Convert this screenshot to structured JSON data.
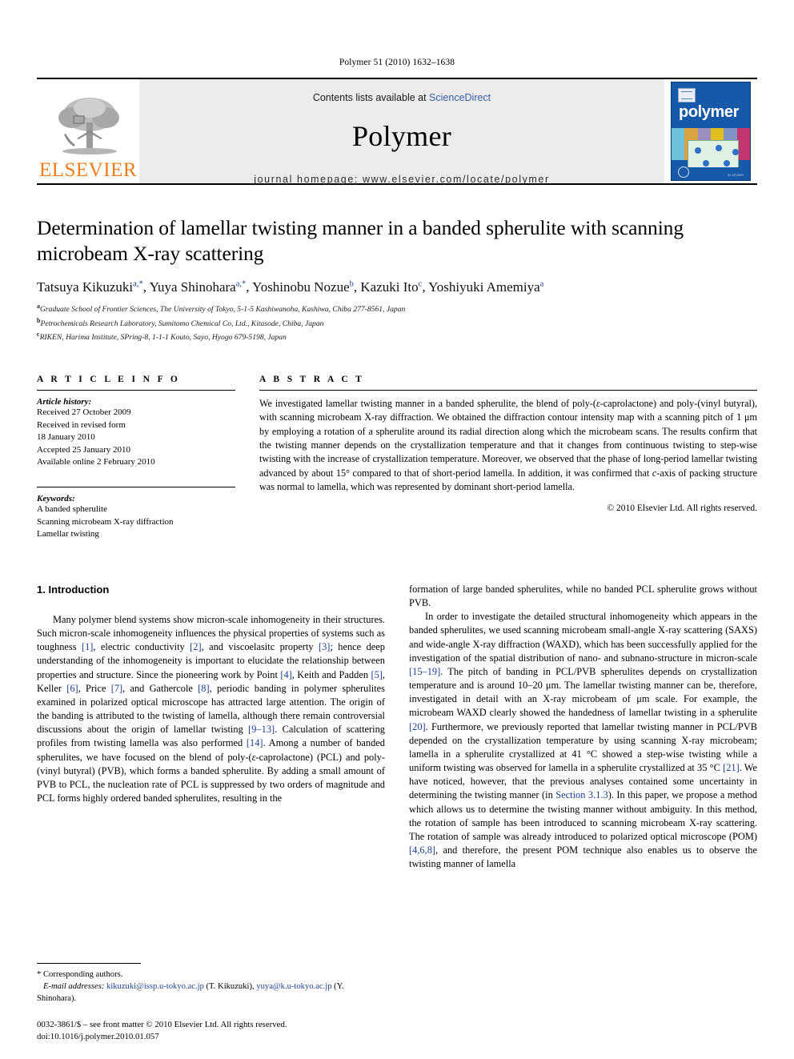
{
  "running_head": "Polymer 51 (2010) 1632–1638",
  "masthead": {
    "publisher_name": "ELSEVIER",
    "contents_prefix": "Contents lists available at ",
    "sciencedirect": "ScienceDirect",
    "journal_name": "Polymer",
    "homepage": "journal homepage: www.elsevier.com/locate/polymer",
    "cover_title": "polymer"
  },
  "article": {
    "title": "Determination of lamellar twisting manner in a banded spherulite with scanning microbeam X-ray scattering",
    "authors_html": "Tatsuya Kikuzuki<sup>a,*</sup>, Yuya Shinohara<sup>a,*</sup>, Yoshinobu Nozue<sup>b</sup>, Kazuki Ito<sup>c</sup>, Yoshiyuki Amemiya<sup>a</sup>",
    "affiliations": [
      "Graduate School of Frontier Sciences, The University of Tokyo, 5-1-5 Kashiwanoha, Kashiwa, Chiba 277-8561, Japan",
      "Petrochemicals Research Laboratory, Sumitomo Chemical Co, Ltd., Kitasode, Chiba, Japan",
      "RIKEN, Harima Institute, SPring-8, 1-1-1 Kouto, Sayo, Hyogo 679-5198, Japan"
    ],
    "affiliation_markers": [
      "a",
      "b",
      "c"
    ]
  },
  "article_info": {
    "heading": "A R T I C L E   I N F O",
    "history_label": "Article history:",
    "history": [
      "Received 27 October 2009",
      "Received in revised form",
      "18 January 2010",
      "Accepted 25 January 2010",
      "Available online 2 February 2010"
    ],
    "keywords_label": "Keywords:",
    "keywords": [
      "A banded spherulite",
      "Scanning microbeam X-ray diffraction",
      "Lamellar twisting"
    ]
  },
  "abstract": {
    "heading": "A B S T R A C T",
    "text": "We investigated lamellar twisting manner in a banded spherulite, the blend of poly-(ε-caprolactone) and poly-(vinyl butyral), with scanning microbeam X-ray diffraction. We obtained the diffraction contour intensity map with a scanning pitch of 1 μm by employing a rotation of a spherulite around its radial direction along which the microbeam scans. The results confirm that the twisting manner depends on the crystallization temperature and that it changes from continuous twisting to step-wise twisting with the increase of crystallization temperature. Moreover, we observed that the phase of long-period lamellar twisting advanced by about 15° compared to that of short-period lamella. In addition, it was confirmed that c-axis of packing structure was normal to lamella, which was represented by dominant short-period lamella.",
    "copyright": "© 2010 Elsevier Ltd. All rights reserved."
  },
  "body": {
    "section_number_title": "1. Introduction",
    "left_paragraph_1": "Many polymer blend systems show micron-scale inhomogeneity in their structures. Such micron-scale inhomogeneity influences the physical properties of systems such as toughness [1], electric conductivity [2], and viscoelasitc property [3]; hence deep understanding of the inhomogeneity is important to elucidate the relationship between properties and structure. Since the pioneering work by Point [4], Keith and Padden [5], Keller [6], Price [7], and Gathercole [8], periodic banding in polymer spherulites examined in polarized optical microscope has attracted large attention. The origin of the banding is attributed to the twisting of lamella, although there remain controversial discussions about the origin of lamellar twisting [9–13]. Calculation of scattering profiles from twisting lamella was also performed [14]. Among a number of banded spherulites, we have focused on the blend of poly-(ε-caprolactone) (PCL) and poly-(vinyl butyral) (PVB), which forms a banded spherulite. By adding a small amount of PVB to PCL, the nucleation rate of PCL is suppressed by two orders of magnitude and PCL forms highly ordered banded spherulites, resulting in the",
    "right_paragraph_1": "formation of large banded spherulites, while no banded PCL spherulite grows without PVB.",
    "right_paragraph_2": "In order to investigate the detailed structural inhomogeneity which appears in the banded spherulites, we used scanning microbeam small-angle X-ray scattering (SAXS) and wide-angle X-ray diffraction (WAXD), which has been successfully applied for the investigation of the spatial distribution of nano- and subnano-structure in micron-scale [15–19]. The pitch of banding in PCL/PVB spherulites depends on crystallization temperature and is around 10–20 μm. The lamellar twisting manner can be, therefore, investigated in detail with an X-ray microbeam of μm scale. For example, the microbeam WAXD clearly showed the handedness of lamellar twisting in a spherulite [20]. Furthermore, we previously reported that lamellar twisting manner in PCL/PVB depended on the crystallization temperature by using scanning X-ray microbeam; lamella in a spherulite crystallized at 41 °C showed a step-wise twisting while a uniform twisting was observed for lamella in a spherulite crystallized at 35 °C [21]. We have noticed, however, that the previous analyses contained some uncertainty in determining the twisting manner (in Section 3.1.3). In this paper, we propose a method which allows us to determine the twisting manner without ambiguity. In this method, the rotation of sample has been introduced to scanning microbeam X-ray scattering. The rotation of sample was already introduced to polarized optical microscope (POM) [4,6,8], and therefore, the present POM technique also enables us to observe the twisting manner of lamella"
  },
  "footnotes": {
    "corresponding": "* Corresponding authors.",
    "email_label": "E-mail addresses:",
    "email_1": "kikuzuki@issp.u-tokyo.ac.jp",
    "email_1_owner": "(T. Kikuzuki),",
    "email_2": "yuya@k.u-tokyo.ac.jp",
    "email_2_owner": "(Y. Shinohara)."
  },
  "imprint": {
    "line1": "0032-3861/$ – see front matter © 2010 Elsevier Ltd. All rights reserved.",
    "line2": "doi:10.1016/j.polymer.2010.01.057"
  },
  "colors": {
    "link_blue": "#1c3f94",
    "sciencedirect_blue": "#3b5ca8",
    "elsevier_orange": "#ef7d1a",
    "cover_blue": "#1559a8",
    "masthead_grey": "#ececec"
  }
}
